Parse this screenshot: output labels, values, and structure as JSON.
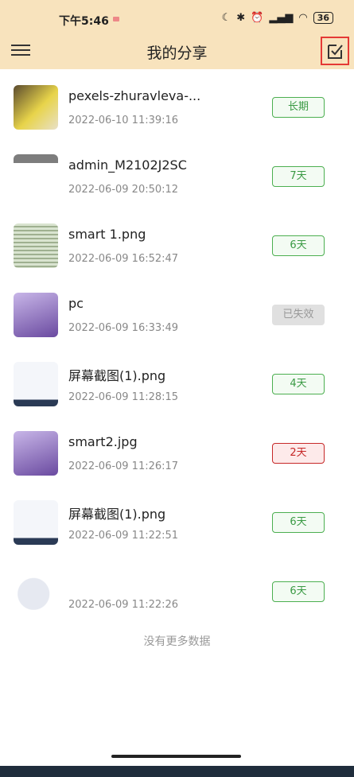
{
  "status": {
    "time": "下午5:46",
    "battery": "36"
  },
  "header": {
    "title": "我的分享"
  },
  "items": [
    {
      "name": "pexels-zhuravleva-...",
      "time": "2022-06-10 11:39:16",
      "badge": "长期",
      "state": "active"
    },
    {
      "name": "admin_M2102J2SC",
      "time": "2022-06-09 20:50:12",
      "badge": "7天",
      "state": "active"
    },
    {
      "name": "smart 1.png",
      "time": "2022-06-09 16:52:47",
      "badge": "6天",
      "state": "active"
    },
    {
      "name": "pc",
      "time": "2022-06-09 16:33:49",
      "badge": "已失效",
      "state": "expired"
    },
    {
      "name": "屏幕截图(1).png",
      "time": "2022-06-09 11:28:15",
      "badge": "4天",
      "state": "active"
    },
    {
      "name": "smart2.jpg",
      "time": "2022-06-09 11:26:17",
      "badge": "2天",
      "state": "warn"
    },
    {
      "name": "屏幕截图(1).png",
      "time": "2022-06-09 11:22:51",
      "badge": "6天",
      "state": "active"
    },
    {
      "name": "",
      "time": "2022-06-09 11:22:26",
      "badge": "6天",
      "state": "active"
    }
  ],
  "footer": {
    "no_more": "没有更多数据"
  },
  "colors": {
    "header_bg": "#f8e3bd",
    "badge_green": "#4caf50",
    "badge_red": "#c62828",
    "highlight": "#e53935"
  }
}
